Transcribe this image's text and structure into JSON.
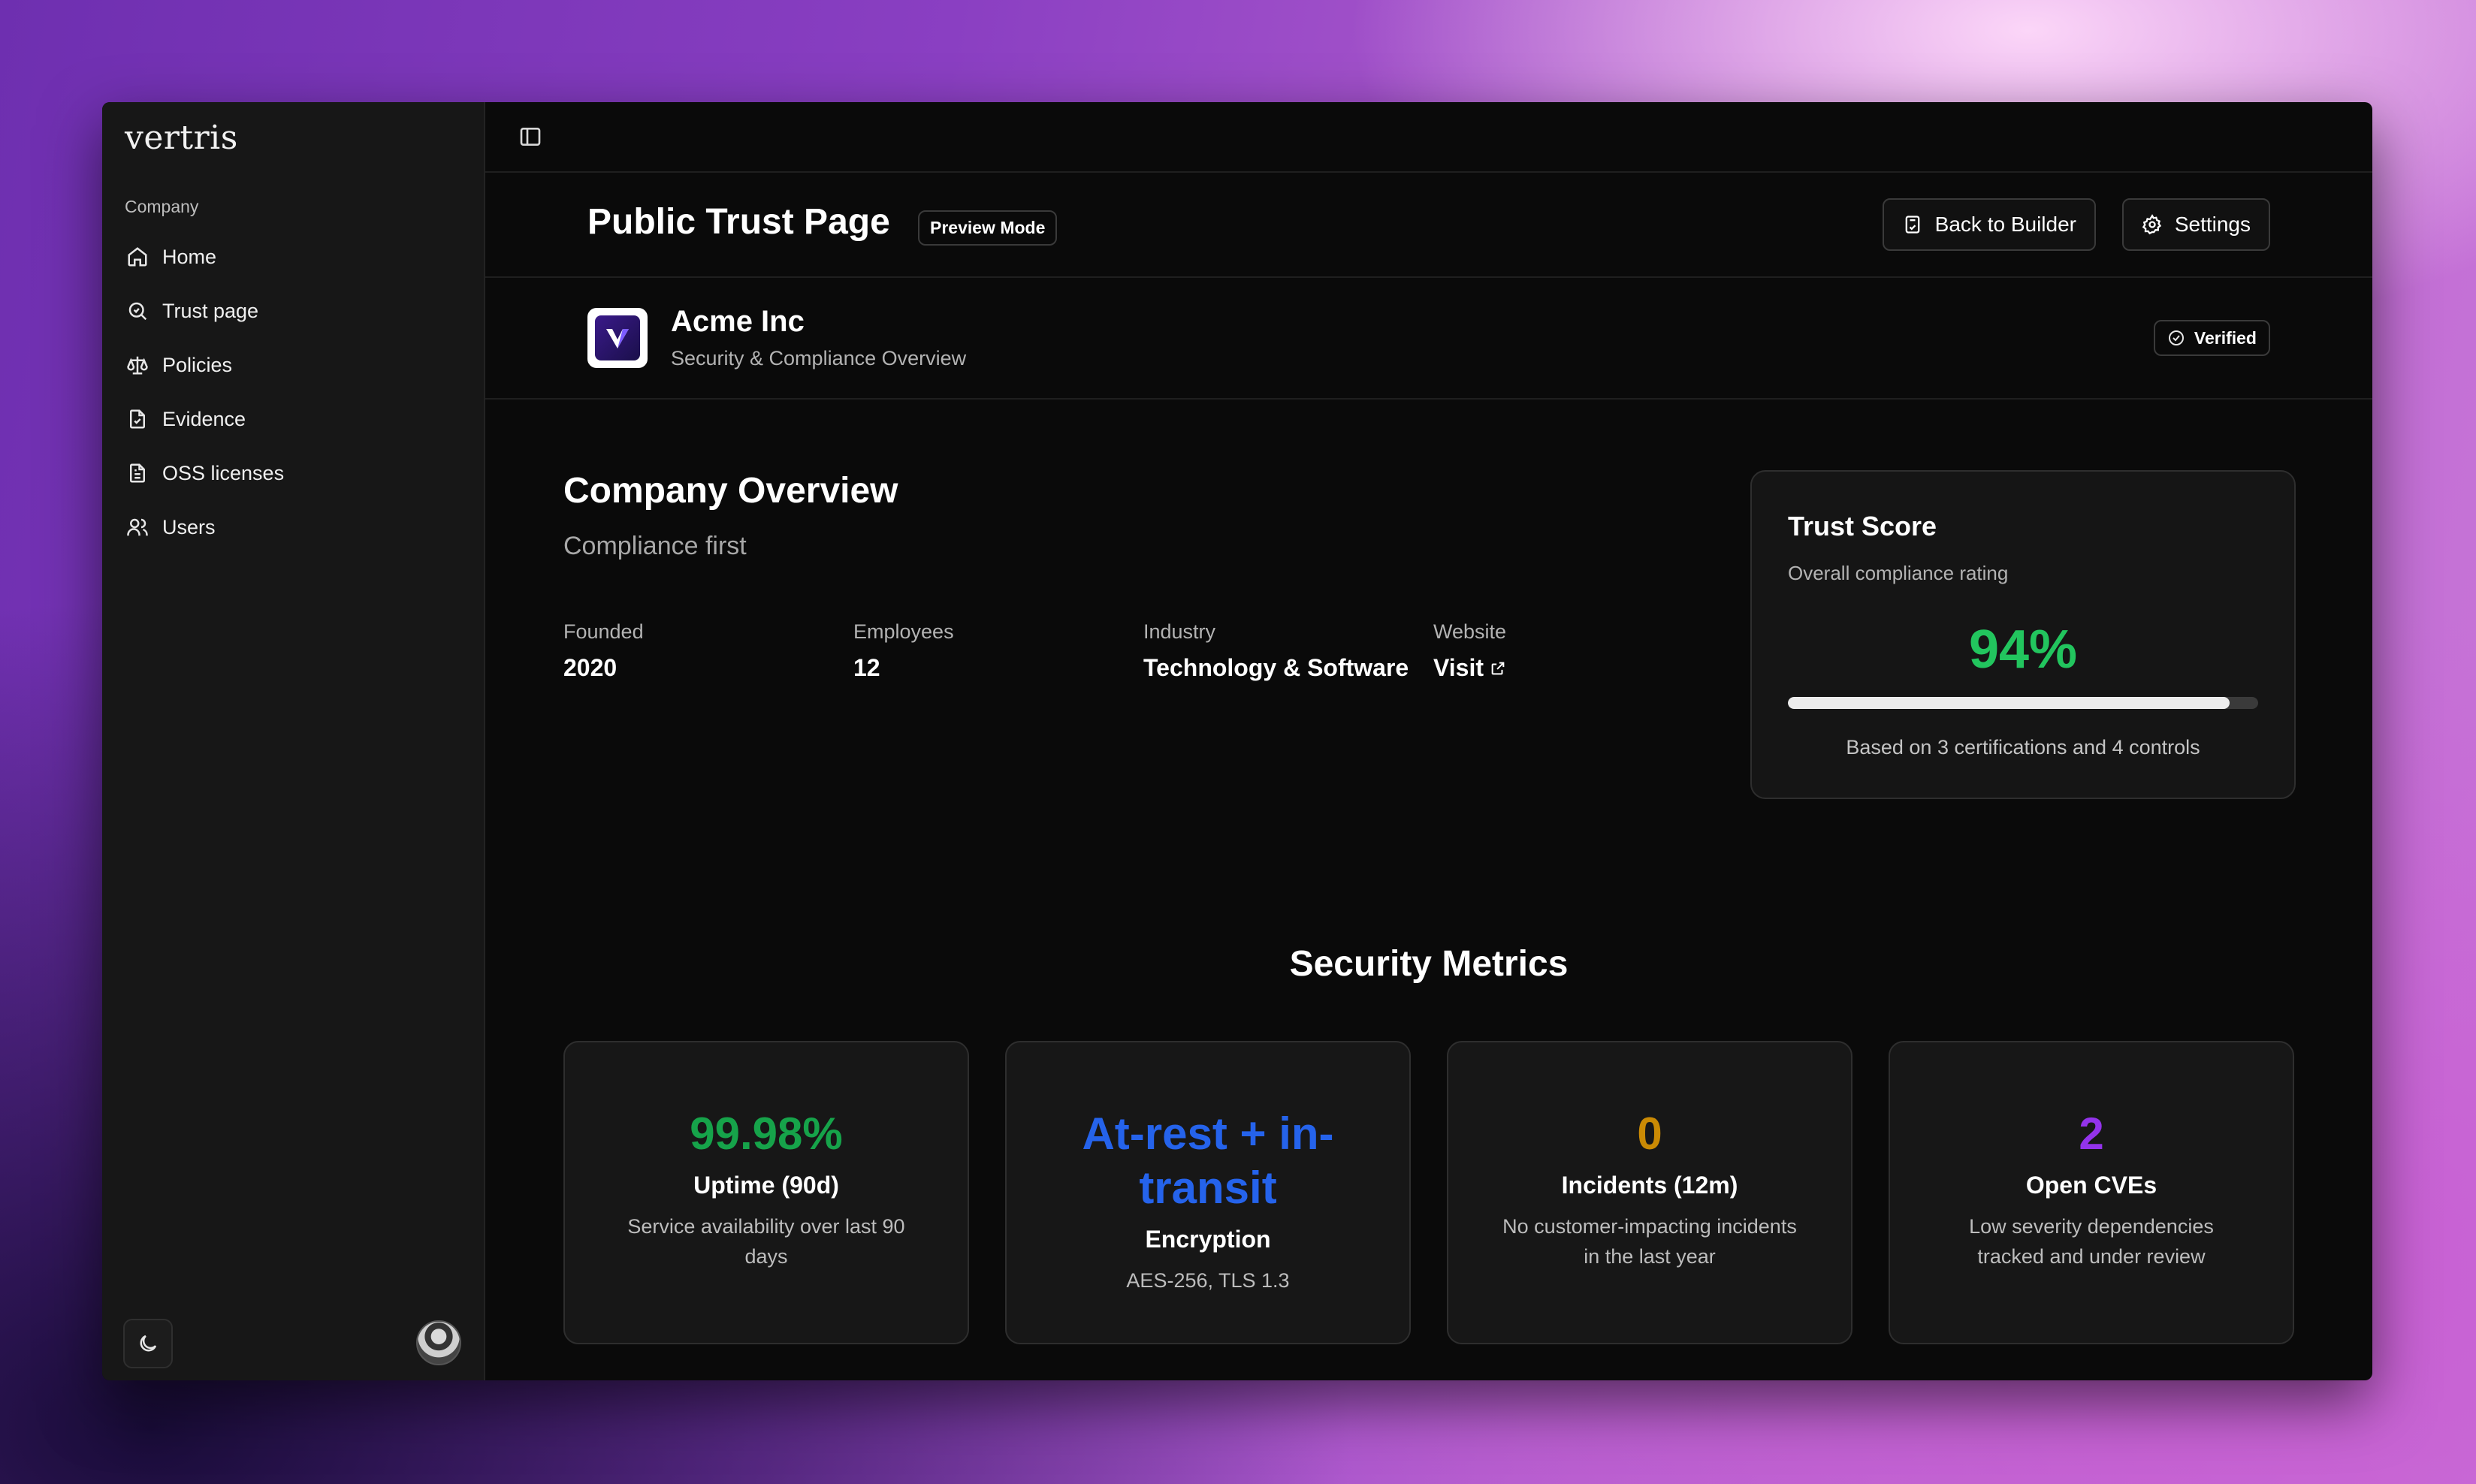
{
  "sidebar": {
    "logo": "vertris",
    "section": "Company",
    "items": [
      {
        "label": "Home",
        "icon": "home-icon"
      },
      {
        "label": "Trust page",
        "icon": "search-icon"
      },
      {
        "label": "Policies",
        "icon": "scale-icon"
      },
      {
        "label": "Evidence",
        "icon": "file-check-icon"
      },
      {
        "label": "OSS licenses",
        "icon": "file-text-icon"
      },
      {
        "label": "Users",
        "icon": "users-icon"
      }
    ]
  },
  "header": {
    "title": "Public Trust Page",
    "badge": "Preview Mode",
    "back_label": "Back to Builder",
    "settings_label": "Settings"
  },
  "company": {
    "name": "Acme Inc",
    "subtitle": "Security & Compliance Overview",
    "verified_label": "Verified"
  },
  "overview": {
    "title": "Company Overview",
    "subtitle": "Compliance first",
    "facts": [
      {
        "label": "Founded",
        "value": "2020"
      },
      {
        "label": "Employees",
        "value": "12"
      },
      {
        "label": "Industry",
        "value": "Technology & Software"
      },
      {
        "label": "Website",
        "value": "Visit"
      }
    ]
  },
  "trust": {
    "title": "Trust Score",
    "subtitle": "Overall compliance rating",
    "score": "94%",
    "score_fraction": 0.94,
    "note": "Based on 3 certifications and 4 controls",
    "accent": "#22c55e"
  },
  "metrics": {
    "title": "Security Metrics",
    "cards": [
      {
        "value": "99.98%",
        "label": "Uptime (90d)",
        "desc": "Service availability over last 90 days",
        "color": "#16a34a"
      },
      {
        "value": "At-rest + in-transit",
        "label": "Encryption",
        "desc": "AES-256, TLS 1.3",
        "color": "#2563eb"
      },
      {
        "value": "0",
        "label": "Incidents (12m)",
        "desc": "No customer-impacting incidents in the last year",
        "color": "#ca8a04"
      },
      {
        "value": "2",
        "label": "Open CVEs",
        "desc": "Low severity dependencies tracked and under review",
        "color": "#9333ea"
      }
    ]
  }
}
